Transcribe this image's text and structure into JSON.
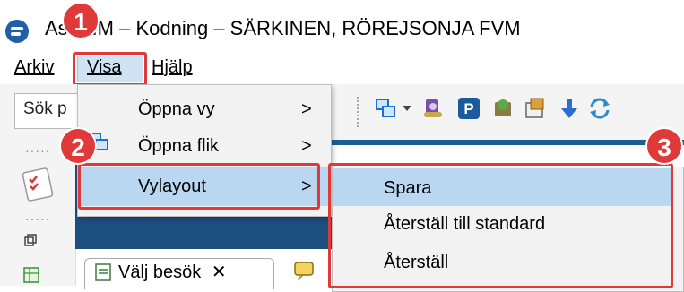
{
  "window": {
    "title": "AssHIM – Kodning – SÄRKINEN, RÖREJSONJA FVM"
  },
  "menubar": {
    "items": [
      {
        "label": "Arkiv"
      },
      {
        "label": "Visa"
      },
      {
        "label": "Hjälp"
      }
    ]
  },
  "toolbar": {
    "search_text": "Sök p"
  },
  "dropdown": {
    "items": [
      {
        "label": "Öppna vy",
        "arrow": ">"
      },
      {
        "label": "Öppna flik",
        "arrow": ">"
      },
      {
        "label": "Vylayout",
        "arrow": ">"
      }
    ]
  },
  "submenu": {
    "items": [
      {
        "label": "Spara"
      },
      {
        "label": "Återställ till standard"
      },
      {
        "label": "Återställ"
      }
    ]
  },
  "tab": {
    "label": "Välj besök",
    "close": "✕"
  },
  "badges": [
    {
      "label": "1"
    },
    {
      "label": "2"
    },
    {
      "label": "3"
    }
  ],
  "colors": {
    "annotation_red": "#e0393a",
    "highlight_blue": "#b9d7f1",
    "header_navy": "#1d4e80"
  }
}
